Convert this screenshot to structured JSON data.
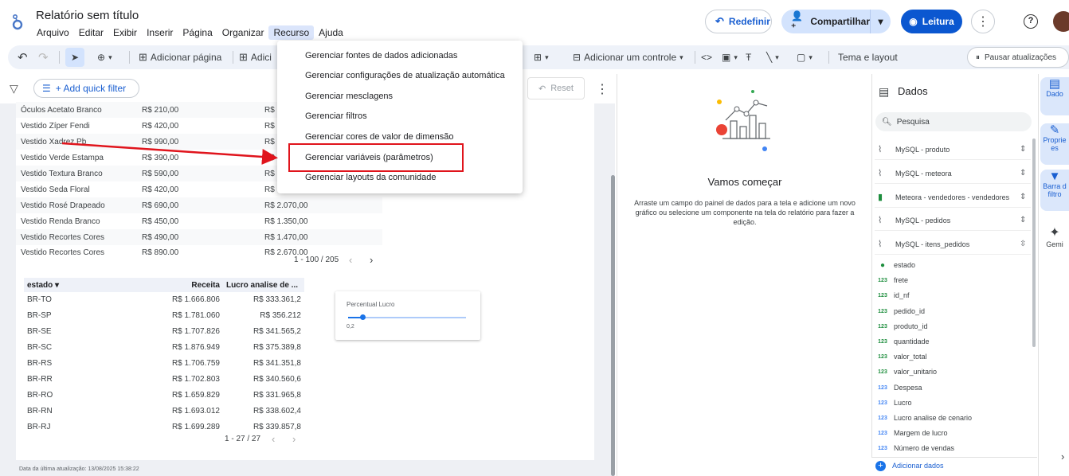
{
  "header": {
    "title": "Relatório sem título",
    "menu": [
      "Arquivo",
      "Editar",
      "Exibir",
      "Inserir",
      "Página",
      "Organizar",
      "Recurso",
      "Ajuda"
    ],
    "reset_label": "Redefinir",
    "share_label": "Compartilhar",
    "read_label": "Leitura"
  },
  "toolbar": {
    "add_page": "Adicionar página",
    "add_data_partial": "Adici",
    "add_control": "Adicionar um controle",
    "theme": "Tema e layout",
    "pause": "Pausar atualizações"
  },
  "filterbar": {
    "quick_filter": "+ Add quick filter",
    "reset": "Reset"
  },
  "dropdown": {
    "items": [
      "Gerenciar fontes de dados adicionadas",
      "Gerenciar configurações de atualização automática",
      "Gerenciar mesclagens",
      "Gerenciar filtros",
      "Gerenciar cores de valor de dimensão",
      "Gerenciar variáveis (parâmetros)",
      "Gerenciar layouts da comunidade"
    ]
  },
  "table1": {
    "rows": [
      [
        "Óculos Acetato Branco",
        "R$ 210,00",
        "R$ "
      ],
      [
        "Vestido Zíper Fendi",
        "R$ 420,00",
        "R$ "
      ],
      [
        "Vestido Xadrez Pb",
        "R$ 990,00",
        "R$ "
      ],
      [
        "Vestido Verde Estampa",
        "R$ 390,00",
        "R$ "
      ],
      [
        "Vestido Textura Branco",
        "R$ 590,00",
        "R$ "
      ],
      [
        "Vestido Seda Floral",
        "R$ 420,00",
        "R$ "
      ],
      [
        "Vestido Rosé Drapeado",
        "R$ 690,00",
        "R$ 2.070,00"
      ],
      [
        "Vestido Renda Branco",
        "R$ 450,00",
        "R$ 1.350,00"
      ],
      [
        "Vestido Recortes Cores",
        "R$ 490,00",
        "R$ 1.470,00"
      ],
      [
        "Vestido Recortes Cores",
        "R$ 890,00",
        "R$ 2.670,00"
      ]
    ],
    "pager": "1 - 100 / 205"
  },
  "table2": {
    "headers": [
      "estado ▾",
      "Receita",
      "Lucro analise de ..."
    ],
    "rows": [
      [
        "BR-TO",
        "R$ 1.666.806",
        "R$ 333.361,2"
      ],
      [
        "BR-SP",
        "R$ 1.781.060",
        "R$ 356.212"
      ],
      [
        "BR-SE",
        "R$ 1.707.826",
        "R$ 341.565,2"
      ],
      [
        "BR-SC",
        "R$ 1.876.949",
        "R$ 375.389,8"
      ],
      [
        "BR-RS",
        "R$ 1.706.759",
        "R$ 341.351,8"
      ],
      [
        "BR-RR",
        "R$ 1.702.803",
        "R$ 340.560,6"
      ],
      [
        "BR-RO",
        "R$ 1.659.829",
        "R$ 331.965,8"
      ],
      [
        "BR-RN",
        "R$ 1.693.012",
        "R$ 338.602,4"
      ],
      [
        "BR-RJ",
        "R$ 1.699.289",
        "R$ 339.857,8"
      ]
    ],
    "pager": "1 - 27 / 27"
  },
  "slider": {
    "label": "Percentual Lucro",
    "value": "0,2",
    "fraction": 0.12
  },
  "footer": "Data da última atualização: 13/08/2025 15:38:22",
  "middle": {
    "heading": "Vamos começar",
    "body": "Arraste um campo do painel de dados para a tela e adicione um novo gráfico ou selecione um componente na tela do relatório para fazer a edição."
  },
  "data_panel": {
    "title": "Dados",
    "search": "Pesquisa",
    "sources": [
      {
        "name": "MySQL - produto",
        "icon": "mysql-icon"
      },
      {
        "name": "MySQL - meteora",
        "icon": "mysql-icon"
      },
      {
        "name": "Meteora - vendedores - vendedores",
        "icon": "sheets-icon"
      },
      {
        "name": "MySQL - pedidos",
        "icon": "mysql-icon"
      },
      {
        "name": "MySQL - itens_pedidos",
        "icon": "mysql-icon"
      }
    ],
    "fields": [
      {
        "name": "estado",
        "type": "geo"
      },
      {
        "name": "frete",
        "type": "num"
      },
      {
        "name": "id_nf",
        "type": "num"
      },
      {
        "name": "pedido_id",
        "type": "num"
      },
      {
        "name": "produto_id",
        "type": "num"
      },
      {
        "name": "quantidade",
        "type": "num"
      },
      {
        "name": "valor_total",
        "type": "num"
      },
      {
        "name": "valor_unitario",
        "type": "num"
      },
      {
        "name": "Despesa",
        "type": "calc"
      },
      {
        "name": "Lucro",
        "type": "calc"
      },
      {
        "name": "Lucro analise de cenario",
        "type": "calc"
      },
      {
        "name": "Margem de lucro",
        "type": "calc"
      },
      {
        "name": "Número de vendas",
        "type": "calc"
      }
    ],
    "add_data": "Adicionar dados"
  },
  "rail": {
    "data": "Dado",
    "props": "Proprie es",
    "filters": "Barra d filtro",
    "gemini": "Gemi"
  },
  "colors": {
    "accent": "#0b57d0",
    "highlight": "#e0141c"
  }
}
